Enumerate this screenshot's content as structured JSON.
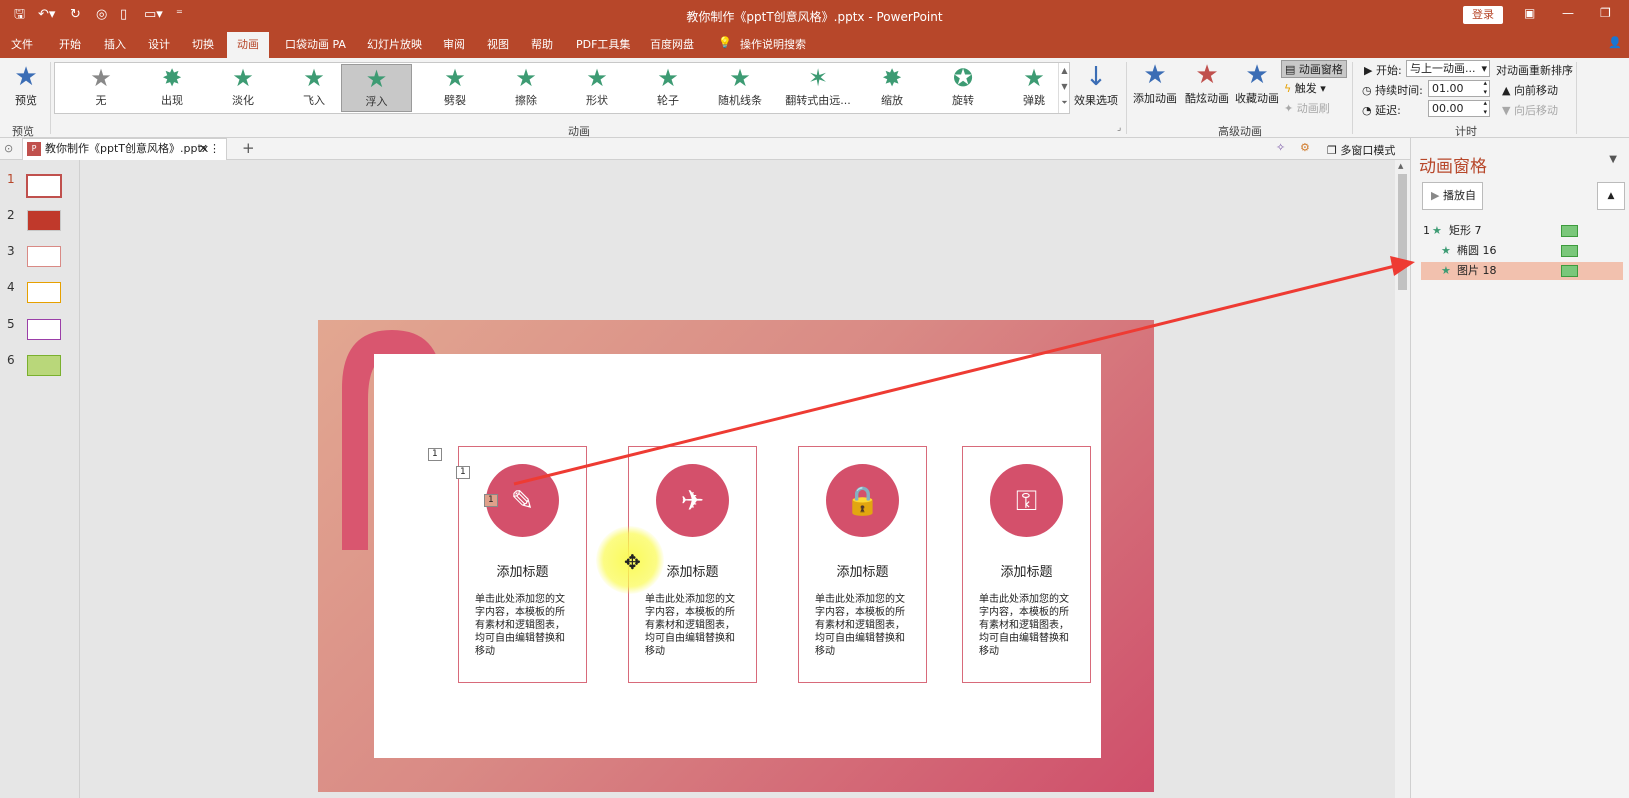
{
  "window": {
    "title": "教你制作《pptT创意风格》.pptx  -  PowerPoint",
    "login_label": "登录"
  },
  "menu_tabs": [
    "文件",
    "开始",
    "插入",
    "设计",
    "切换",
    "动画",
    "口袋动画 PA",
    "幻灯片放映",
    "审阅",
    "视图",
    "帮助",
    "PDF工具集",
    "百度网盘",
    "操作说明搜索"
  ],
  "ribbon": {
    "preview_label": "预览",
    "preview_group": "预览",
    "animation_group": "动画",
    "animations": [
      "无",
      "出现",
      "淡化",
      "飞入",
      "浮入",
      "劈裂",
      "擦除",
      "形状",
      "轮子",
      "随机线条",
      "翻转式由远...",
      "缩放",
      "旋转",
      "弹跳"
    ],
    "selected_animation": "浮入",
    "effect_options_label": "效果选项",
    "advanced_group": "高级动画",
    "add_animation_label": "添加动画",
    "cool_animation_label": "酷炫动画",
    "collect_animation_label": "收藏动画",
    "animation_pane_label": "动画窗格",
    "trigger_label": "触发",
    "animation_painter_label": "动画刷",
    "timing_group": "计时",
    "start_label": "开始:",
    "start_value": "与上一动画...",
    "duration_label": "持续时间:",
    "duration_value": "01.00",
    "delay_label": "延迟:",
    "delay_value": "00.00",
    "reorder_label": "对动画重新排序",
    "move_earlier_label": "向前移动",
    "move_later_label": "向后移动"
  },
  "doc_tab": {
    "name": "教你制作《pptT创意风格》.pptx",
    "multiwindow_label": "多窗口模式"
  },
  "thumbnails": [
    "1",
    "2",
    "3",
    "4",
    "5",
    "6"
  ],
  "active_slide": "1",
  "slide": {
    "cards": [
      {
        "title": "添加标题",
        "body": "单击此处添加您的文字内容，本模板的所有素材和逻辑图表，均可自由编辑替换和移动",
        "icon": "pencil-icon"
      },
      {
        "title": "添加标题",
        "body": "单击此处添加您的文字内容，本模板的所有素材和逻辑图表，均可自由编辑替换和移动",
        "icon": "airplane-icon"
      },
      {
        "title": "添加标题",
        "body": "单击此处添加您的文字内容，本模板的所有素材和逻辑图表，均可自由编辑替换和移动",
        "icon": "lock-icon"
      },
      {
        "title": "添加标题",
        "body": "单击此处添加您的文字内容，本模板的所有素材和逻辑图表，均可自由编辑替换和移动",
        "icon": "key-icon"
      }
    ],
    "tags": [
      "1",
      "1",
      "1"
    ]
  },
  "animation_pane": {
    "title": "动画窗格",
    "play_label": "播放自",
    "items": [
      {
        "index": "1",
        "name": "矩形 7"
      },
      {
        "index": "",
        "name": "椭圆 16"
      },
      {
        "index": "",
        "name": "图片 18"
      }
    ],
    "accent": "#f2c1ae"
  }
}
